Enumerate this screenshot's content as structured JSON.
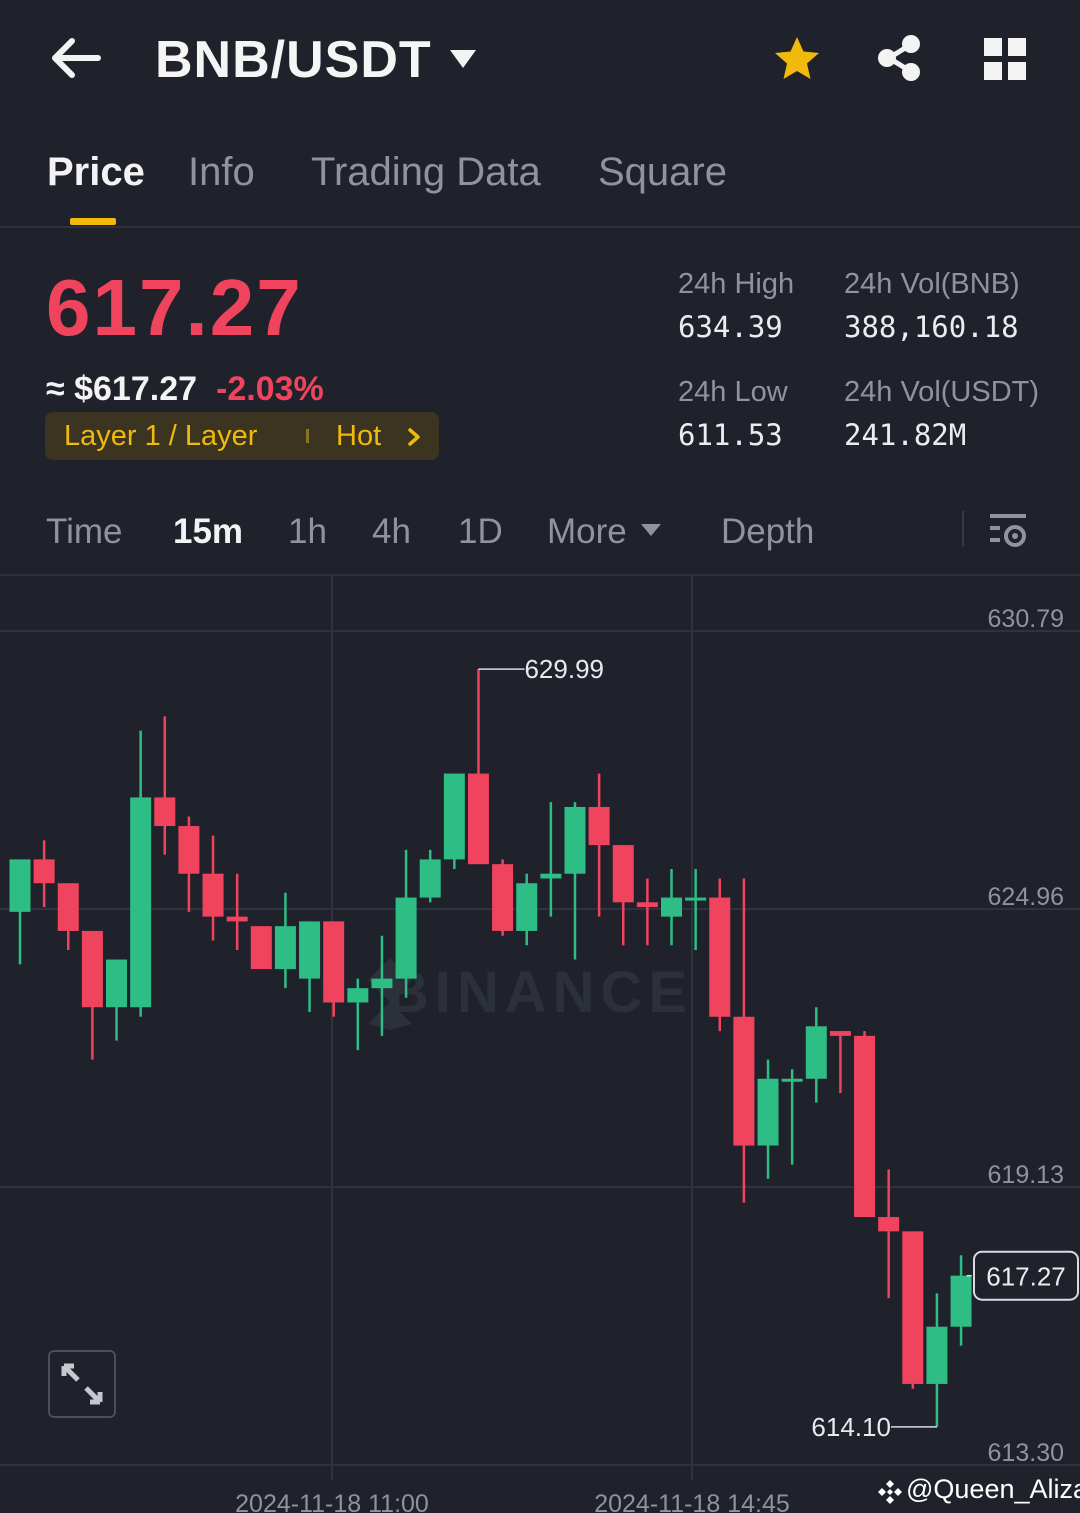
{
  "header": {
    "pair": "BNB/USDT",
    "icons": [
      "back-arrow-icon",
      "dropdown-caret-icon",
      "star-icon",
      "share-icon",
      "grid-icon"
    ],
    "star_color": "#f0b90b"
  },
  "tabs": [
    {
      "label": "Price",
      "active": true
    },
    {
      "label": "Info",
      "active": false
    },
    {
      "label": "Trading Data",
      "active": false
    },
    {
      "label": "Square",
      "active": false
    }
  ],
  "price": {
    "last": "617.27",
    "approx": "≈ $617.27",
    "change": "-2.03%",
    "tag_category": "Layer 1 / Layer",
    "tag_hot": "Hot"
  },
  "stats": {
    "high_label": "24h High",
    "high_value": "634.39",
    "low_label": "24h Low",
    "low_value": "611.53",
    "vol_base_label": "24h Vol(BNB)",
    "vol_base_value": "388,160.18",
    "vol_quote_label": "24h Vol(USDT)",
    "vol_quote_value": "241.82M"
  },
  "intervals": {
    "time": "Time",
    "m15": "15m",
    "h1": "1h",
    "h4": "4h",
    "d1": "1D",
    "more": "More",
    "depth": "Depth",
    "active": "15m"
  },
  "colors": {
    "up": "#2ebd85",
    "down": "#f0445e",
    "accent": "#f0b90b"
  },
  "watermark": "@Queen_Aliza",
  "chart_data": {
    "type": "candlestick",
    "y_ticks": [
      "630.79",
      "624.96",
      "619.13",
      "613.30"
    ],
    "ylim": [
      613.3,
      630.79
    ],
    "x_ticks": [
      "2024-11-18 11:00",
      "2024-11-18 14:45"
    ],
    "high_marker": "629.99",
    "low_marker": "614.10",
    "last_marker": "617.27",
    "candles": [
      {
        "o": 624.9,
        "h": 626.0,
        "l": 623.8,
        "c": 626.0
      },
      {
        "o": 626.0,
        "h": 626.4,
        "l": 625.0,
        "c": 625.5
      },
      {
        "o": 625.5,
        "h": 625.5,
        "l": 624.1,
        "c": 624.5
      },
      {
        "o": 624.5,
        "h": 624.5,
        "l": 621.8,
        "c": 622.9
      },
      {
        "o": 622.9,
        "h": 623.3,
        "l": 622.2,
        "c": 623.9
      },
      {
        "o": 622.9,
        "h": 628.7,
        "l": 622.7,
        "c": 627.3
      },
      {
        "o": 627.3,
        "h": 629.0,
        "l": 626.1,
        "c": 626.7
      },
      {
        "o": 626.7,
        "h": 626.9,
        "l": 624.9,
        "c": 625.7
      },
      {
        "o": 625.7,
        "h": 626.5,
        "l": 624.3,
        "c": 624.8
      },
      {
        "o": 624.8,
        "h": 625.7,
        "l": 624.1,
        "c": 624.7
      },
      {
        "o": 624.6,
        "h": 624.6,
        "l": 623.9,
        "c": 623.7
      },
      {
        "o": 623.7,
        "h": 625.3,
        "l": 623.3,
        "c": 624.6
      },
      {
        "o": 623.5,
        "h": 624.7,
        "l": 622.8,
        "c": 624.7
      },
      {
        "o": 624.7,
        "h": 624.7,
        "l": 622.7,
        "c": 623.0
      },
      {
        "o": 623.0,
        "h": 623.5,
        "l": 622.0,
        "c": 623.3
      },
      {
        "o": 623.3,
        "h": 624.4,
        "l": 622.3,
        "c": 623.5
      },
      {
        "o": 623.5,
        "h": 626.2,
        "l": 623.1,
        "c": 625.2
      },
      {
        "o": 625.2,
        "h": 626.2,
        "l": 625.1,
        "c": 626.0
      },
      {
        "o": 626.0,
        "h": 627.7,
        "l": 625.8,
        "c": 627.8
      },
      {
        "o": 627.8,
        "h": 629.99,
        "l": 626.0,
        "c": 625.9
      },
      {
        "o": 625.9,
        "h": 626.0,
        "l": 624.4,
        "c": 624.5
      },
      {
        "o": 624.5,
        "h": 625.7,
        "l": 624.2,
        "c": 625.5
      },
      {
        "o": 625.6,
        "h": 627.2,
        "l": 624.8,
        "c": 625.7
      },
      {
        "o": 625.7,
        "h": 627.2,
        "l": 623.9,
        "c": 627.1
      },
      {
        "o": 627.1,
        "h": 627.8,
        "l": 624.8,
        "c": 626.3
      },
      {
        "o": 626.3,
        "h": 626.3,
        "l": 624.2,
        "c": 625.1
      },
      {
        "o": 625.1,
        "h": 625.6,
        "l": 624.2,
        "c": 625.0
      },
      {
        "o": 624.8,
        "h": 625.8,
        "l": 624.2,
        "c": 625.2
      },
      {
        "o": 625.2,
        "h": 625.8,
        "l": 624.1,
        "c": 625.2
      },
      {
        "o": 625.2,
        "h": 625.6,
        "l": 622.4,
        "c": 622.7
      },
      {
        "o": 622.7,
        "h": 625.6,
        "l": 618.8,
        "c": 620.0
      },
      {
        "o": 620.0,
        "h": 621.8,
        "l": 619.3,
        "c": 621.4
      },
      {
        "o": 621.4,
        "h": 621.6,
        "l": 619.6,
        "c": 621.4
      },
      {
        "o": 621.4,
        "h": 622.9,
        "l": 620.9,
        "c": 622.5
      },
      {
        "o": 622.4,
        "h": 622.4,
        "l": 621.1,
        "c": 622.3
      },
      {
        "o": 622.3,
        "h": 622.4,
        "l": 618.5,
        "c": 618.5
      },
      {
        "o": 618.5,
        "h": 619.5,
        "l": 616.8,
        "c": 618.2
      },
      {
        "o": 618.2,
        "h": 618.2,
        "l": 614.9,
        "c": 615.0
      },
      {
        "o": 615.0,
        "h": 616.9,
        "l": 614.1,
        "c": 616.2
      },
      {
        "o": 616.2,
        "h": 617.7,
        "l": 615.8,
        "c": 617.27
      }
    ]
  }
}
